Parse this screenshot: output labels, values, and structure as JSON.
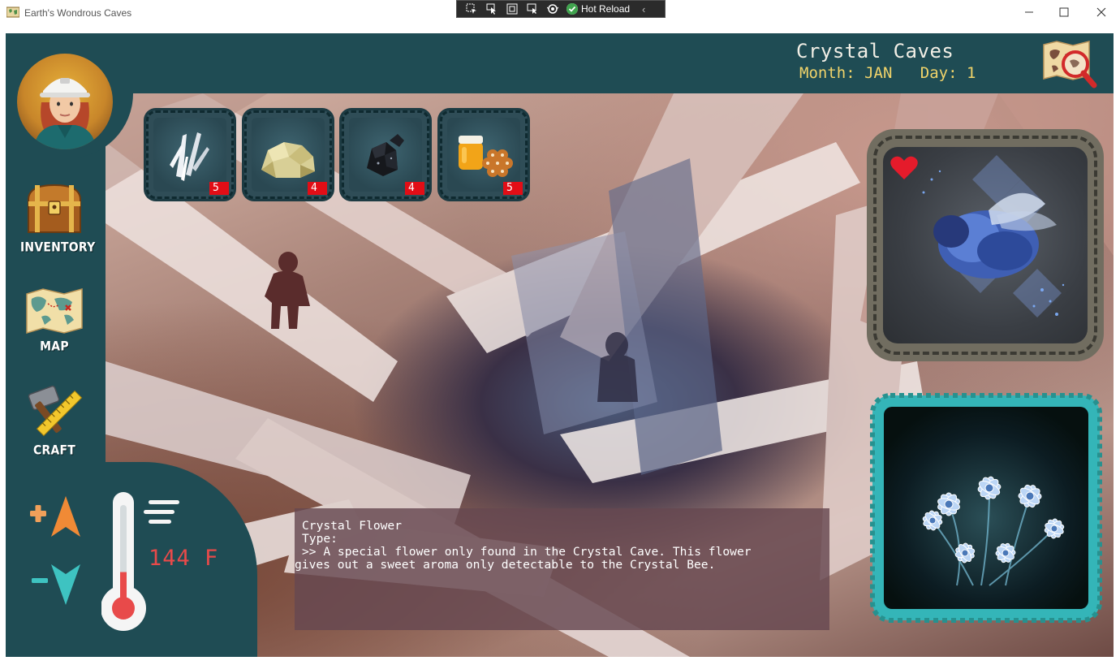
{
  "window": {
    "title": "Earth's Wondrous Caves",
    "hot_reload_label": "Hot Reload",
    "devbar_icons": [
      "select-element-icon",
      "inspect-cursor-icon",
      "layout-adorner-icon",
      "track-focus-icon",
      "binding-failures-icon",
      "hot-reload-check-icon"
    ],
    "controls": [
      "minimize-icon",
      "maximize-icon",
      "close-icon"
    ]
  },
  "header": {
    "location": "Crystal Caves",
    "month_label": "Month:",
    "month_value": "JAN",
    "day_label": "Day:",
    "day_value": "1",
    "world_map_icon": "globe-search-icon"
  },
  "sidebar": {
    "avatar": "explorer-avatar",
    "items": [
      {
        "label": "INVENTORY",
        "icon": "treasure-chest-icon"
      },
      {
        "label": "MAP",
        "icon": "map-icon"
      },
      {
        "label": "CRAFT",
        "icon": "hammer-ruler-icon"
      }
    ]
  },
  "temperature": {
    "value": "144",
    "unit": "F",
    "increase_icon": "plus-up-arrow-icon",
    "decrease_icon": "minus-down-arrow-icon",
    "gauge_icon": "thermometer-icon",
    "level": 0.35
  },
  "resources": [
    {
      "name": "quartz-crystal",
      "count": "5"
    },
    {
      "name": "sulfur-rock",
      "count": "4"
    },
    {
      "name": "coal-ore",
      "count": "4"
    },
    {
      "name": "honey-and-honeycomb",
      "count": "5"
    }
  ],
  "creature": {
    "name": "crystal-bee",
    "favorite_icon": "heart-icon"
  },
  "selected_item": {
    "name": "crystal-flower"
  },
  "dialog": {
    "title": "Crystal Flower",
    "type_line": "Type:",
    "description_line1": ">> A special flower only found in the Crystal Cave. This flower",
    "description_line2": "gives out a sweet aroma only detectable to the Crystal Bee."
  },
  "colors": {
    "panel": "#1f4c54",
    "accent_gold": "#f0d36a",
    "temperature": "#e84a4a",
    "count_badge": "#e20d16",
    "flower_frame": "#34b5b8"
  }
}
